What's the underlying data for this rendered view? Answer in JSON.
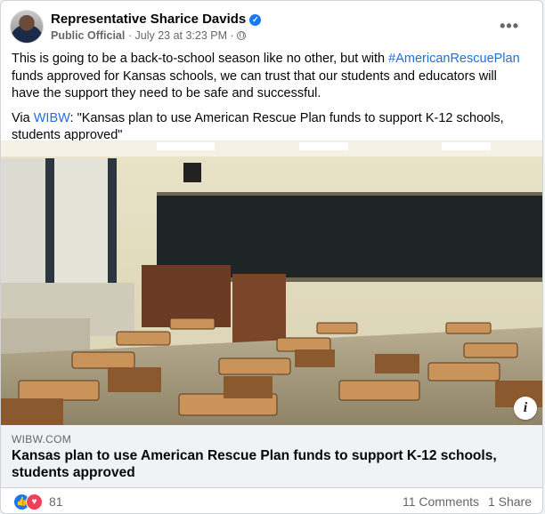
{
  "post": {
    "author": "Representative Sharice Davids",
    "role": "Public Official",
    "date": "July 23 at 3:23 PM",
    "separator": "·",
    "body_before_tag": "This is going to be a back-to-school season like no other, but with ",
    "hashtag": "#AmericanRescuePlan",
    "body_after_tag": " funds approved for Kansas schools, we can trust that our students and educators will have the support they need to be safe and successful.",
    "via_prefix": "Via ",
    "via_link": "WIBW",
    "via_quote": ": \"Kansas plan to use American Rescue Plan funds to support K-12 schools, students approved\""
  },
  "preview": {
    "domain": "WIBW.COM",
    "title": "Kansas plan to use American Rescue Plan funds to support K-12 schools, students approved",
    "info_icon": "i"
  },
  "engagement": {
    "reaction_count": "81",
    "comments": "11 Comments",
    "shares": "1 Share"
  },
  "icons": {
    "verified": "verified-badge-icon",
    "globe": "globe-icon",
    "more": "more-options-icon",
    "like": "like-reaction-icon",
    "love": "love-reaction-icon",
    "info": "info-icon"
  },
  "colors": {
    "link": "#216fdb",
    "brand": "#1877f2",
    "love": "#f33e58",
    "meta": "#65676b"
  }
}
